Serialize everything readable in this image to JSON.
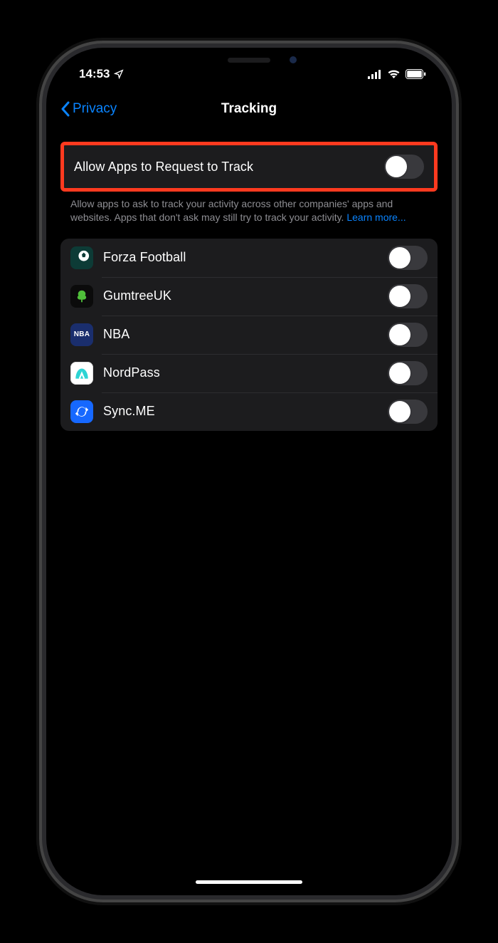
{
  "statusbar": {
    "time": "14:53"
  },
  "nav": {
    "back": "Privacy",
    "title": "Tracking"
  },
  "main_setting": {
    "label": "Allow Apps to Request to Track"
  },
  "footer": {
    "text": "Allow apps to ask to track your activity across other companies' apps and websites. Apps that don't ask may still try to track your activity. ",
    "link": "Learn more..."
  },
  "apps": [
    {
      "name": "Forza Football",
      "icon_bg": "#0d3b36",
      "icon_glyph": "⚽"
    },
    {
      "name": "GumtreeUK",
      "icon_bg": "#0b0b0b",
      "icon_glyph": "tree"
    },
    {
      "name": "NBA",
      "icon_bg": "#1a2e6d",
      "icon_glyph": "NBA",
      "icon_text": true
    },
    {
      "name": "NordPass",
      "icon_bg": "#ffffff",
      "icon_glyph": "nord"
    },
    {
      "name": "Sync.ME",
      "icon_bg": "#1668ff",
      "icon_glyph": "sync"
    }
  ]
}
